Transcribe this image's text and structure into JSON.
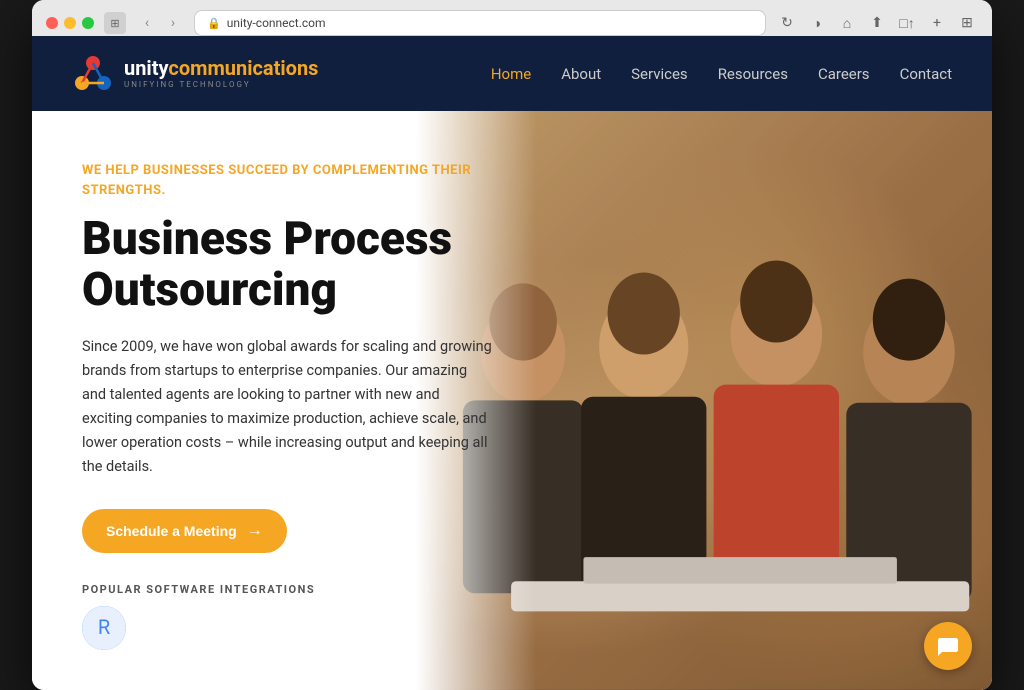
{
  "browser": {
    "url": "unity-connect.com",
    "tab_icon": "🔒"
  },
  "site": {
    "logo": {
      "unity": "unity",
      "communications": "communications",
      "tagline": "UNIFYING TECHNOLOGY"
    },
    "nav": {
      "home": "Home",
      "about": "About",
      "services": "Services",
      "resources": "Resources",
      "careers": "Careers",
      "contact": "Contact",
      "active": "Home"
    },
    "hero": {
      "tagline": "WE HELP BUSINESSES SUCCEED BY COMPLEMENTING THEIR STRENGTHS.",
      "heading_line1": "Business Process",
      "heading_line2": "Outsourcing",
      "body": "Since 2009, we have won global awards for scaling and growing brands from startups to enterprise companies. Our amazing and talented agents are looking to partner with new and exciting companies to maximize production, achieve scale, and lower operation costs – while increasing output and keeping all the details.",
      "cta_label": "Schedule a Meeting",
      "cta_arrow": "→",
      "popular_label": "POPULAR SOFTWARE INTEGRATIONS"
    }
  }
}
